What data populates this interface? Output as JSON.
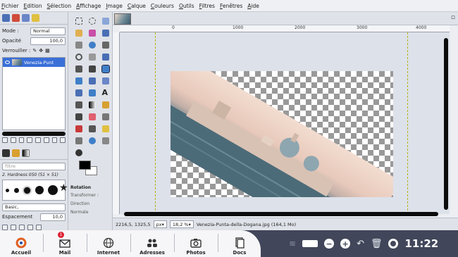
{
  "menubar": [
    "Fichier",
    "Edition",
    "Sélection",
    "Affichage",
    "Image",
    "Calque",
    "Couleurs",
    "Outils",
    "Filtres",
    "Fenêtres",
    "Aide"
  ],
  "layers": {
    "mode_label": "Mode :",
    "mode_value": "Normal",
    "opacity_label": "Opacité",
    "opacity_value": "100,0",
    "lock_label": "Verrouiller :",
    "layer_name": "Venezia-Punt"
  },
  "brushes": {
    "filter_placeholder": "filtre",
    "brush_name": "2. Hardness 050 (51 × 51)",
    "preset": "Basic,",
    "spacing_label": "Espacement",
    "spacing_value": "10,0"
  },
  "tool_options": {
    "title": "Rotation",
    "transform_label": "Transformer :",
    "direction_label": "Direction",
    "direction_value": "Normale"
  },
  "ruler": {
    "labels": [
      "0",
      "1000",
      "2000",
      "3000",
      "4000"
    ]
  },
  "status": {
    "coords": "2216,5, 1325,5",
    "unit": "px",
    "zoom": "18,2 %",
    "file": "Venezia-Punta-della-Dogana.jpg (164,1 Mo)"
  },
  "taskbar": {
    "apps": [
      {
        "label": "Accueil",
        "icon": "home-logo-icon"
      },
      {
        "label": "Mail",
        "icon": "mail-icon",
        "badge": "1"
      },
      {
        "label": "Internet",
        "icon": "globe-icon"
      },
      {
        "label": "Adresses",
        "icon": "contacts-icon"
      },
      {
        "label": "Photos",
        "icon": "camera-icon"
      },
      {
        "label": "Docs",
        "icon": "documents-icon"
      }
    ],
    "clock": "11:22"
  }
}
